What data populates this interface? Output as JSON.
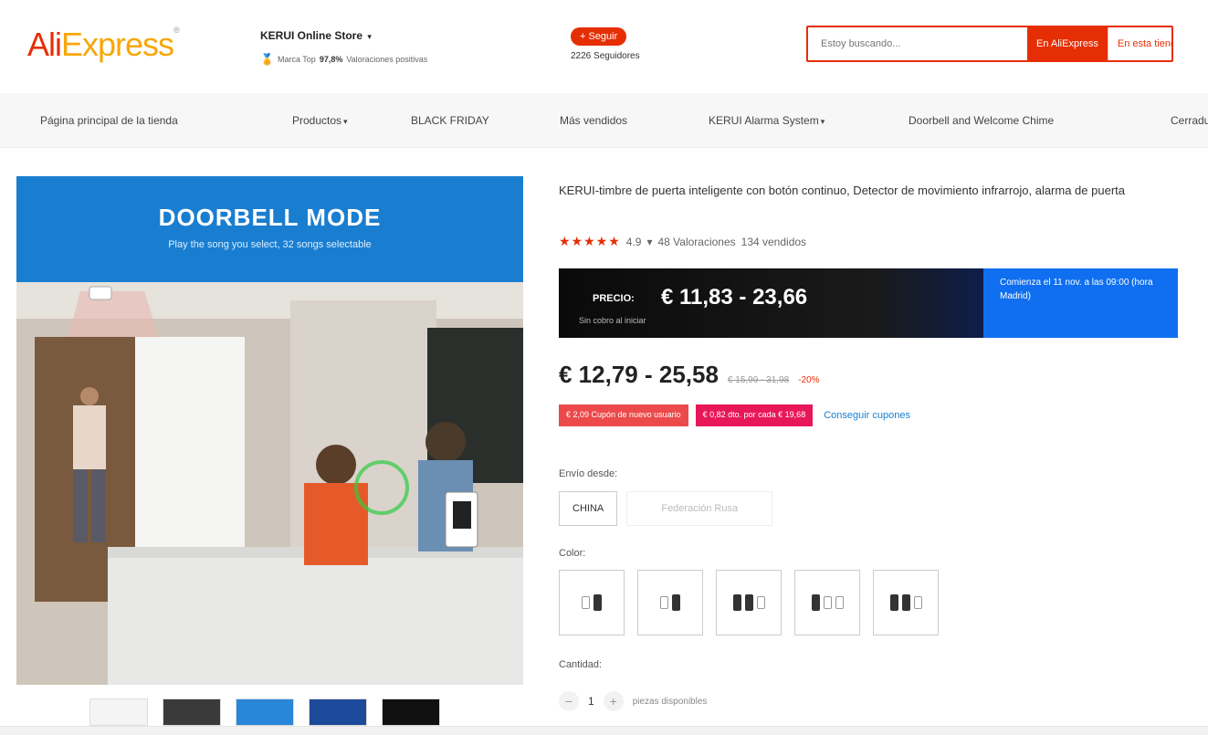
{
  "header": {
    "logo_part1": "Ali",
    "logo_part2": "Express",
    "store_name": "KERUI Online Store",
    "store_badge": "Marca Top",
    "store_rating": "97,8%",
    "store_rating_label": "Valoraciones positivas",
    "follow_label": "+ Seguir",
    "followers": "2226 Seguidores",
    "search_placeholder": "Estoy buscando...",
    "search_btn_ali": "En AliExpress",
    "search_btn_store": "En esta tienda"
  },
  "nav": {
    "items": [
      "Página principal de la tienda",
      "Productos",
      "BLACK FRIDAY",
      "Más vendidos",
      "KERUI Alarma System",
      "Doorbell and Welcome Chime",
      "Cerradura"
    ]
  },
  "image": {
    "banner_title": "DOORBELL MODE",
    "banner_sub": "Play the song you select, 32 songs selectable"
  },
  "product": {
    "title": "KERUI-timbre de puerta inteligente con botón continuo, Detector de movimiento infrarrojo, alarma de puerta",
    "rating": "4.9",
    "reviews": "48 Valoraciones",
    "sold": "134 vendidos",
    "promo_label": "PRECIO:",
    "promo_price": "€ 11,83 - 23,66",
    "promo_note": "Sin cobro al iniciar",
    "promo_right": "Comienza el 11 nov. a las 09:00 (hora Madrid)",
    "price": "€ 12,79 - 25,58",
    "old_price": "€ 15,99 - 31,98",
    "discount": "-20%",
    "coupon1": "€ 2,09 Cupón de nuevo usuario",
    "coupon2": "€ 0,82 dto. por cada € 19,68",
    "coupon_link": "Conseguir cupones",
    "ship_label": "Envío desde:",
    "ship_opt1": "CHINA",
    "ship_opt2": "Federación Rusa",
    "color_label": "Color:",
    "qty_label": "Cantidad:",
    "qty_value": "1",
    "qty_available": "piezas disponibles"
  }
}
